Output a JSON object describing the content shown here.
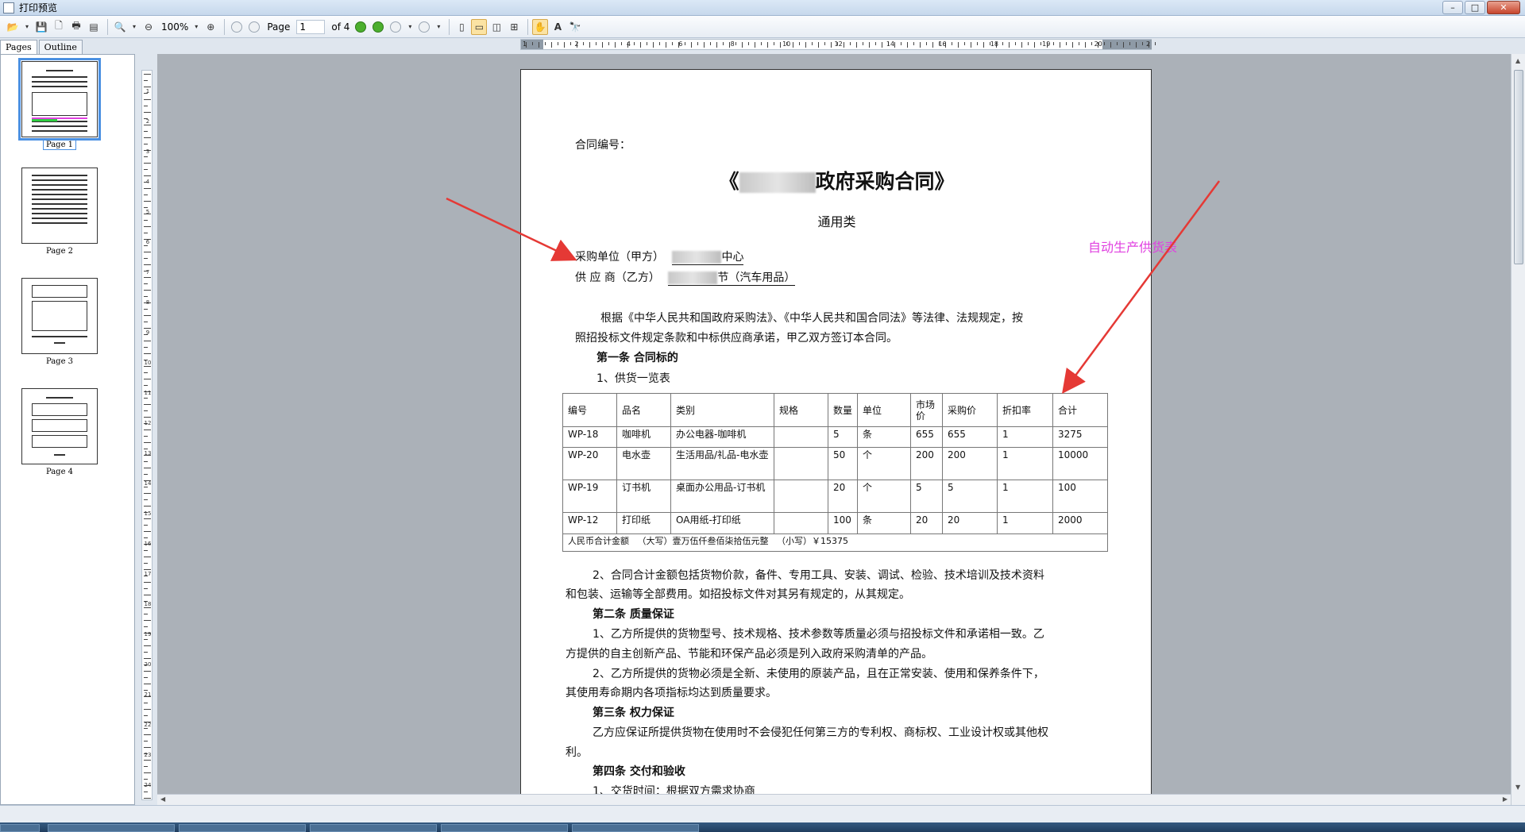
{
  "window": {
    "title": "打印预览",
    "buttons": {
      "minimize": "–",
      "maximize": "□",
      "close": "✕"
    }
  },
  "toolbar": {
    "zoom": "100%",
    "page_label": "Page",
    "page_value": "1",
    "page_of": "of 4",
    "icons": [
      "open-icon",
      "save-icon",
      "new-icon",
      "print-icon",
      "export-icon",
      "zoom-in-icon",
      "zoom-out-icon",
      "zoom-reset-icon",
      "first-page-icon",
      "previous-page-icon",
      "next-page-icon",
      "last-page-icon",
      "back-icon",
      "forward-icon",
      "single-page-icon",
      "fit-width-icon",
      "two-pages-icon",
      "four-pages-icon",
      "hand-tool-icon",
      "text-select-icon",
      "find-icon"
    ]
  },
  "sidebar": {
    "tabs": [
      {
        "label": "Pages",
        "active": true
      },
      {
        "label": "Outline",
        "active": false
      }
    ],
    "thumbnails": [
      {
        "label": "Page 1",
        "selected": true
      },
      {
        "label": "Page 2",
        "selected": false
      },
      {
        "label": "Page 3",
        "selected": false
      },
      {
        "label": "Page 4",
        "selected": false
      }
    ]
  },
  "rulers": {
    "horizontal": [
      "1",
      "2",
      "4",
      "6",
      "8",
      "10",
      "12",
      "14",
      "16",
      "18",
      "19",
      "20",
      "2"
    ],
    "vertical": [
      "1",
      "2",
      "3",
      "4",
      "5",
      "6",
      "7",
      "8",
      "9",
      "10",
      "11",
      "12",
      "13",
      "14",
      "15",
      "16",
      "17",
      "18",
      "19",
      "20",
      "21",
      "22",
      "23",
      "24"
    ]
  },
  "document": {
    "contract_no_label": "合同编号：",
    "title_prefix": "《",
    "title_suffix": "政府采购合同》",
    "subtitle": "通用类",
    "buyer_label": "采购单位（甲方）",
    "buyer_suffix": "中心",
    "supplier_label": "供 应 商（乙方）",
    "supplier_suffix": "节（汽车用品）",
    "intro_line1": "根据《中华人民共和国政府采购法》、《中华人民共和国合同法》等法律、法规规定，按",
    "intro_line2": "照招投标文件规定条款和中标供应商承诺，甲乙双方签订本合同。",
    "art1_heading": "第一条 合同标的",
    "art1_sub": "1、供货一览表",
    "table": {
      "headers": [
        "编号",
        "品名",
        "类别",
        "规格",
        "数量",
        "单位",
        "市场价",
        "采购价",
        "折扣率",
        "合计"
      ],
      "rows": [
        [
          "WP-18",
          "咖啡机",
          "办公电器-咖啡机",
          "",
          "5",
          "条",
          "655",
          "655",
          "1",
          "3275"
        ],
        [
          "WP-20",
          "电水壶",
          "生活用品/礼品-电水壶",
          "",
          "50",
          "个",
          "200",
          "200",
          "1",
          "10000"
        ],
        [
          "WP-19",
          "订书机",
          "桌面办公用品-订书机",
          "",
          "20",
          "个",
          "5",
          "5",
          "1",
          "100"
        ],
        [
          "WP-12",
          "打印纸",
          "OA用纸-打印纸",
          "",
          "100",
          "条",
          "20",
          "20",
          "1",
          "2000"
        ]
      ],
      "total_label": "人民币合计金额",
      "total_upper": "（大写）壹万伍仟叁佰柒拾伍元整",
      "total_lower": "（小写）￥15375"
    },
    "art1_p2_line1": "2、合同合计金额包括货物价款，备件、专用工具、安装、调试、检验、技术培训及技术资料",
    "art1_p2_line2": "和包装、运输等全部费用。如招投标文件对其另有规定的，从其规定。",
    "art2_heading": "第二条 质量保证",
    "art2_p1_line1": "1、乙方所提供的货物型号、技术规格、技术参数等质量必须与招投标文件和承诺相一致。乙",
    "art2_p1_line2": "方提供的自主创新产品、节能和环保产品必须是列入政府采购清单的产品。",
    "art2_p2_line1": "2、乙方所提供的货物必须是全新、未使用的原装产品，且在正常安装、使用和保养条件下，",
    "art2_p2_line2": "其使用寿命期内各项指标均达到质量要求。",
    "art3_heading": "第三条 权力保证",
    "art3_line1": "乙方应保证所提供货物在使用时不会侵犯任何第三方的专利权、商标权、工业设计权或其他权",
    "art3_line2": "利。",
    "art4_heading": "第四条 交付和验收",
    "art4_p1": "1、交货时间：根据双方需求协商"
  },
  "annotation": {
    "text": "自动生产供货表",
    "color": "#e040e0",
    "arrow_color": "#e53935"
  }
}
